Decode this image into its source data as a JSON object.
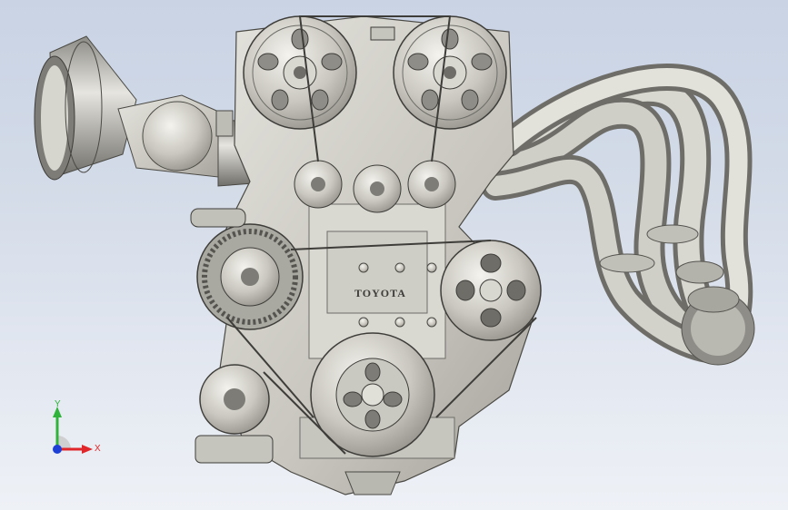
{
  "model": {
    "engraving": "TOYOTA"
  },
  "triad": {
    "x_label": "X",
    "y_label": "Y",
    "colors": {
      "x": "#e0262a",
      "y": "#2fb33a",
      "z": "#1d3fd6"
    }
  },
  "icons": [
    "engine-model",
    "axis-triad-icon"
  ]
}
